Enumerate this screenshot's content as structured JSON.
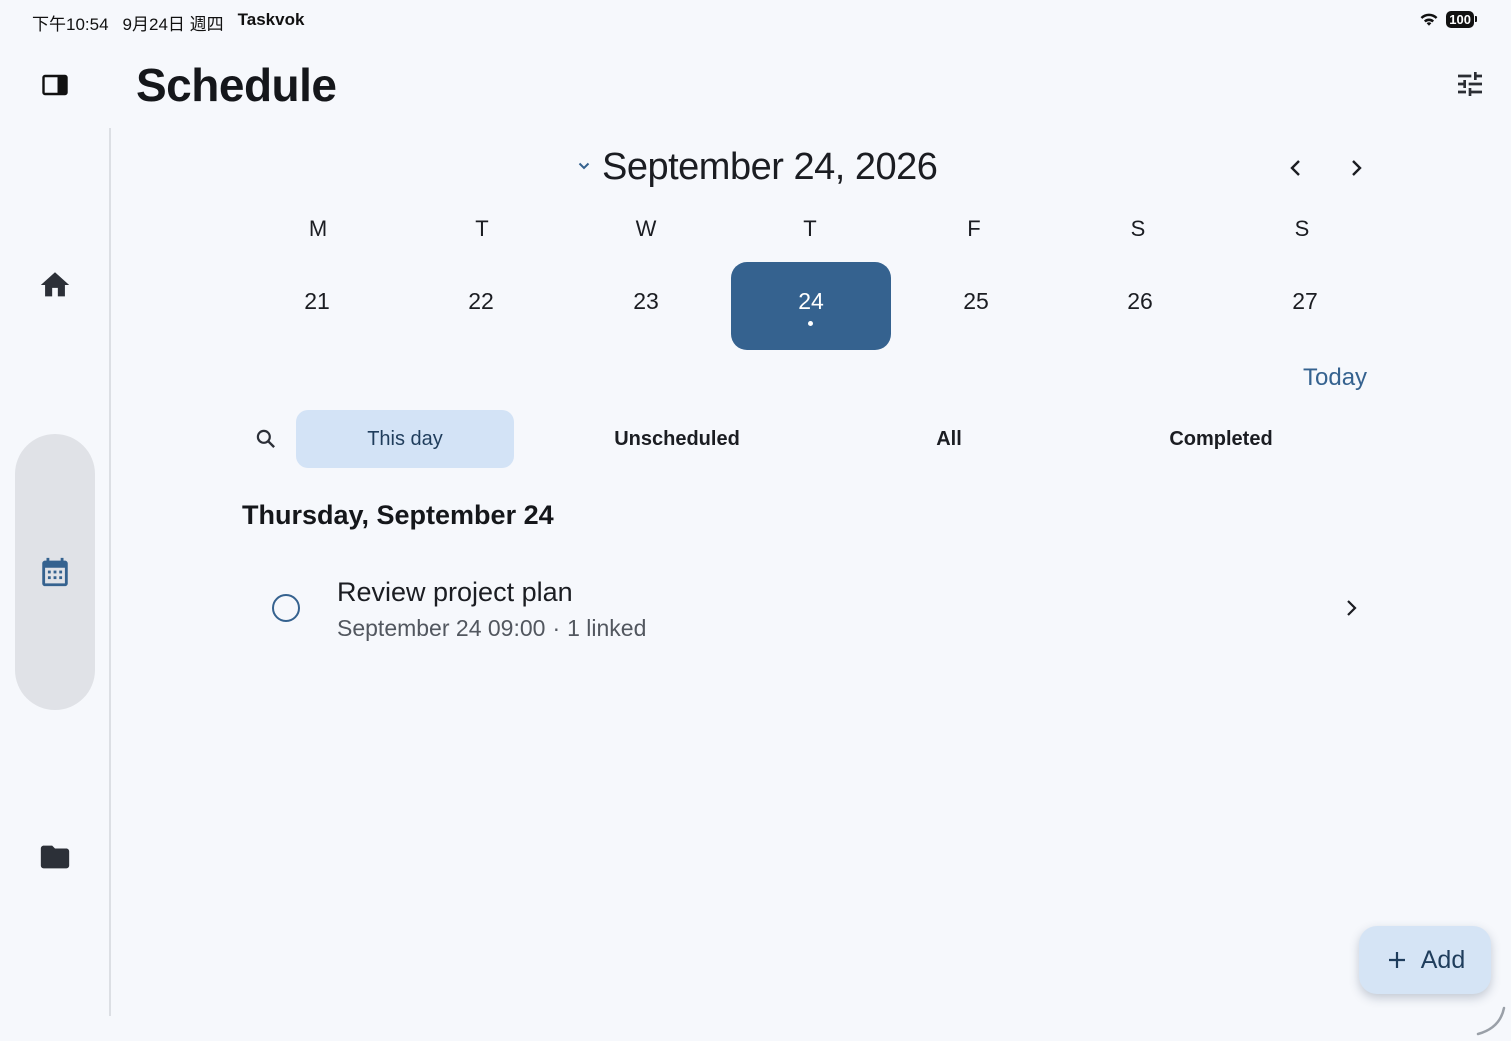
{
  "status_bar": {
    "time": "下午10:54",
    "date": "9月24日 週四",
    "app_name": "Taskvok",
    "battery": "100"
  },
  "header": {
    "title": "Schedule"
  },
  "nav_rail": {
    "items": [
      {
        "name": "home",
        "icon": "home-icon"
      },
      {
        "name": "calendar",
        "icon": "calendar-icon",
        "selected": true
      },
      {
        "name": "folder",
        "icon": "folder-icon"
      }
    ]
  },
  "calendar": {
    "month_title": "September 24, 2026",
    "weekdays": [
      "M",
      "T",
      "W",
      "T",
      "F",
      "S",
      "S"
    ],
    "days": [
      "21",
      "22",
      "23",
      "24",
      "25",
      "26",
      "27"
    ],
    "selected_day": "24",
    "today_label": "Today"
  },
  "filters": {
    "chips": [
      "This day",
      "Unscheduled",
      "All",
      "Completed"
    ],
    "active": "This day"
  },
  "section": {
    "heading": "Thursday, September 24"
  },
  "tasks": [
    {
      "title": "Review project plan",
      "datetime": "September 24 09:00",
      "separator": "·",
      "linked": "1 linked",
      "completed": false
    }
  ],
  "fab": {
    "label": "Add"
  },
  "colors": {
    "accent": "#35628f",
    "chip_active_bg": "#d3e3f6",
    "background": "#f6f8fc",
    "rail_pill": "#e0e2e7"
  }
}
